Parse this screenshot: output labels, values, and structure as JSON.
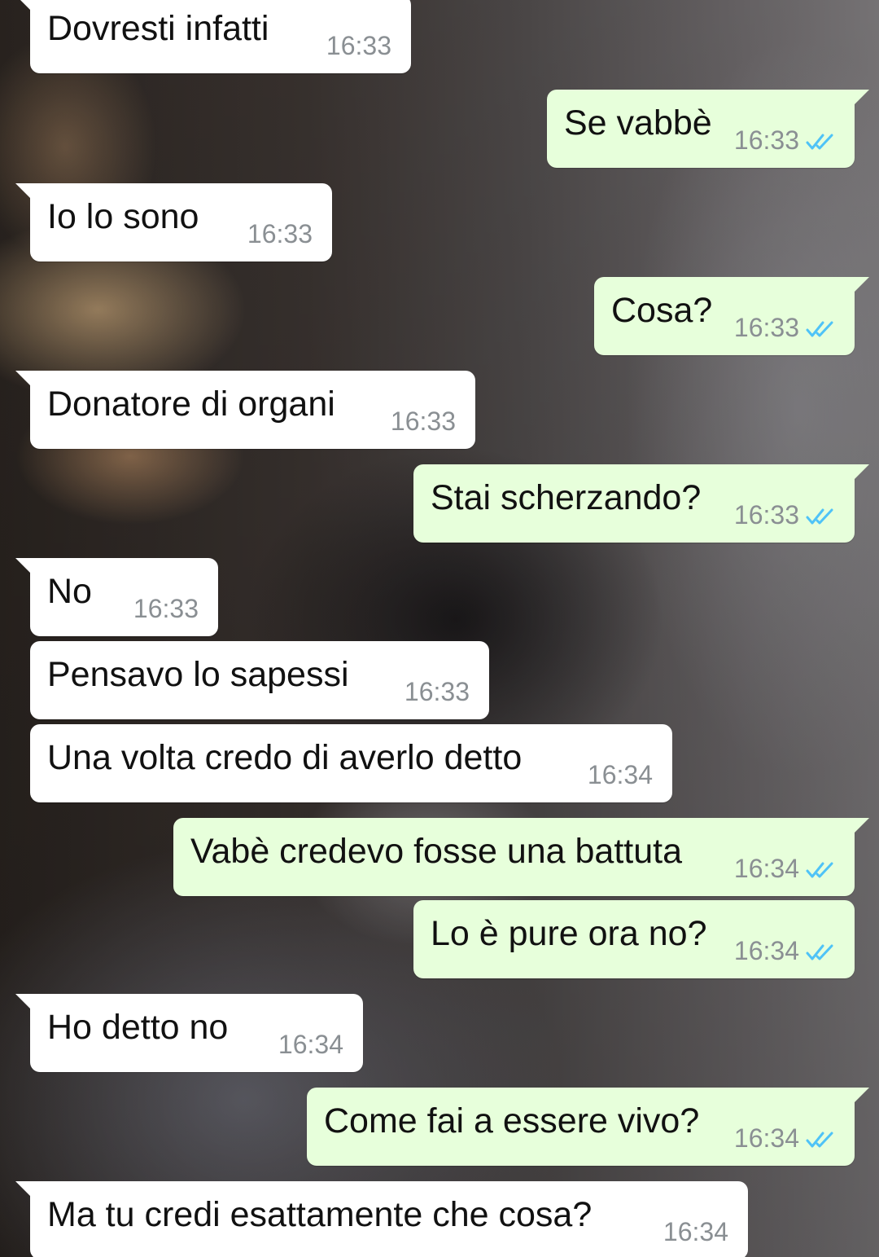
{
  "chat": {
    "tick_color": "#4fc3f7",
    "incoming_bubble_color": "#ffffff",
    "outgoing_bubble_color": "#e7ffdb",
    "messages": [
      {
        "direction": "in",
        "text": "Dovresti infatti",
        "time": "16:33"
      },
      {
        "direction": "out",
        "text": "Se vabbè",
        "time": "16:33",
        "status": "read-double-tick"
      },
      {
        "direction": "in",
        "text": "Io lo sono",
        "time": "16:33"
      },
      {
        "direction": "out",
        "text": "Cosa?",
        "time": "16:33",
        "status": "read-double-tick"
      },
      {
        "direction": "in",
        "text": "Donatore di organi",
        "time": "16:33"
      },
      {
        "direction": "out",
        "text": "Stai scherzando?",
        "time": "16:33",
        "status": "read-double-tick"
      },
      {
        "direction": "in",
        "text": "No",
        "time": "16:33"
      },
      {
        "direction": "in",
        "text": "Pensavo lo sapessi",
        "time": "16:33"
      },
      {
        "direction": "in",
        "text": "Una volta credo di averlo detto",
        "time": "16:34"
      },
      {
        "direction": "out",
        "text": "Vabè credevo fosse una battuta",
        "time": "16:34",
        "status": "read-double-tick"
      },
      {
        "direction": "out",
        "text": "Lo è pure ora no?",
        "time": "16:34",
        "status": "read-double-tick"
      },
      {
        "direction": "in",
        "text": "Ho detto no",
        "time": "16:34"
      },
      {
        "direction": "out",
        "text": "Come fai a essere vivo?",
        "time": "16:34",
        "status": "read-double-tick"
      },
      {
        "direction": "in",
        "text": "Ma tu credi esattamente che cosa?",
        "time": "16:34"
      }
    ]
  }
}
